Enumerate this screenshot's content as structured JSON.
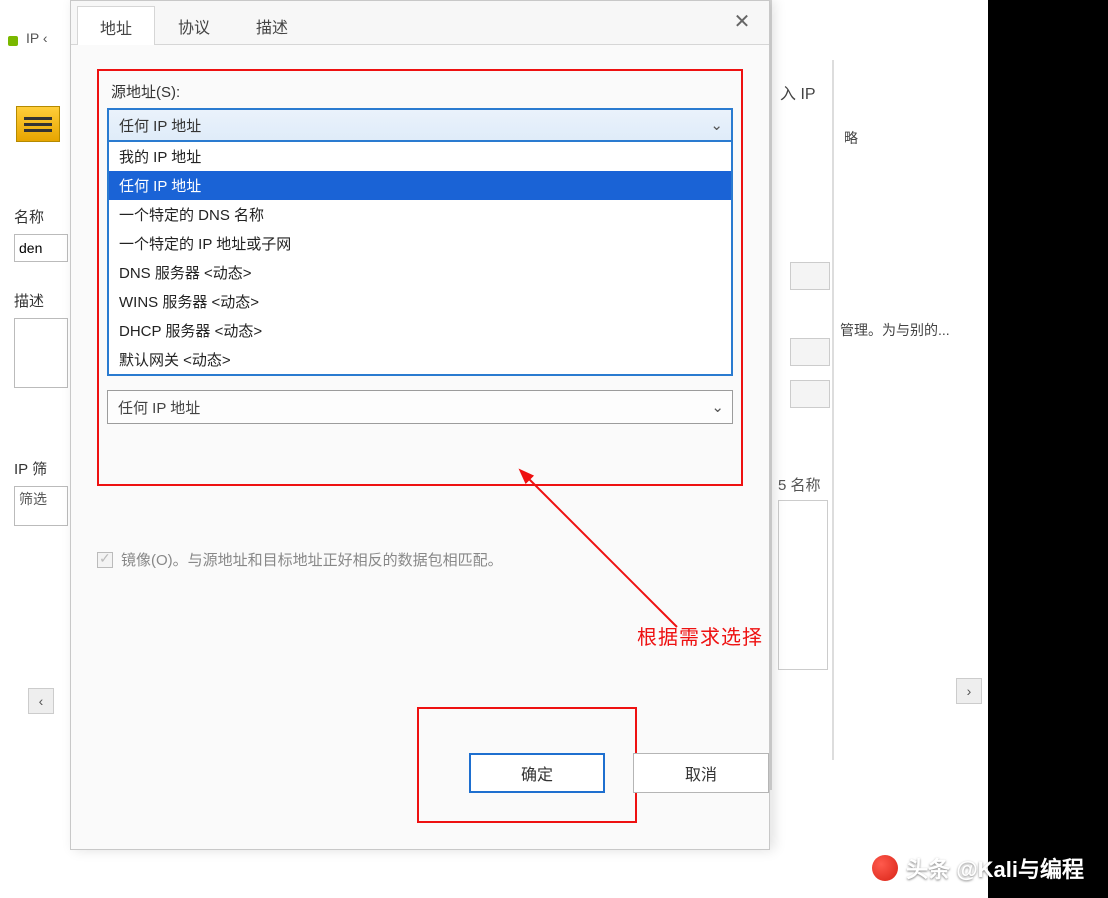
{
  "left_window": {
    "tab_ip": "IP ‹",
    "label_name": "名称",
    "input_name_value": "den",
    "label_desc": "描述",
    "label_ipfilter": "IP 筛",
    "list_prefix": "筛选"
  },
  "back_window": {
    "stub_ip": "入 IP",
    "stub_policy": "略",
    "stub_mgmt": "管理。为与别的...",
    "stub_name": "5 名称"
  },
  "dialog": {
    "tabs": {
      "t1": "地址",
      "t2": "协议",
      "t3": "描述"
    },
    "group_label_src": "源地址(S):",
    "combo_src_value": "任何 IP 地址",
    "dropdown_options": [
      "我的 IP 地址",
      "任何 IP 地址",
      "一个特定的 DNS 名称",
      "一个特定的 IP 地址或子网",
      "DNS 服务器 <动态>",
      "WINS 服务器 <动态>",
      "DHCP 服务器 <动态>",
      "默认网关 <动态>"
    ],
    "selected_index": 1,
    "combo_dst_value": "任何 IP 地址",
    "mirror_label": "镜像(O)。与源地址和目标地址正好相反的数据包相匹配。",
    "ok": "确定",
    "cancel": "取消"
  },
  "annotation": {
    "text": "根据需求选择"
  },
  "watermark": {
    "text": "头条 @Kali与编程"
  }
}
